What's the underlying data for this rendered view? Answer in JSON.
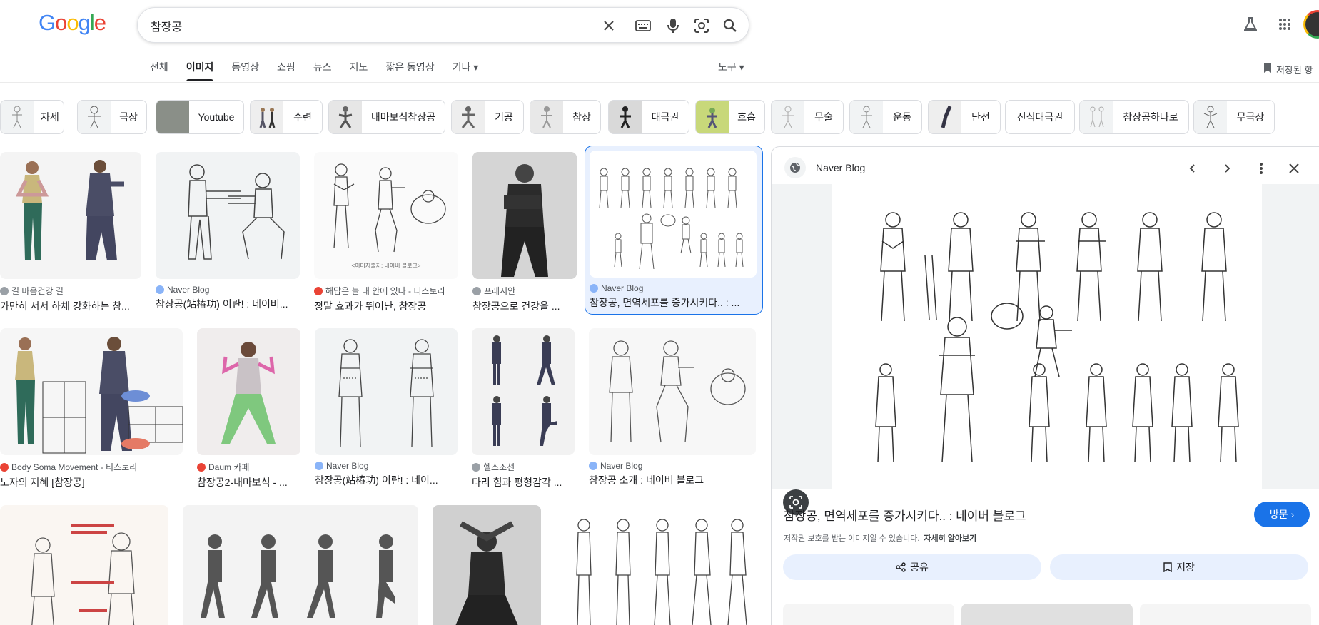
{
  "logo": [
    "G",
    "o",
    "o",
    "g",
    "l",
    "e"
  ],
  "search": {
    "value": "참장공"
  },
  "tabs": [
    "전체",
    "이미지",
    "동영상",
    "쇼핑",
    "뉴스",
    "지도",
    "짧은 동영상",
    "기타 ▾"
  ],
  "tools_label": "도구 ▾",
  "saved_label": "저장된 항",
  "chips": [
    "자세",
    "극장",
    "Youtube",
    "수련",
    "내마보식참장공",
    "기공",
    "참장",
    "태극권",
    "호흡",
    "무술",
    "운동",
    "단전",
    "진식태극권",
    "참장공하나로",
    "무극장"
  ],
  "results": [
    {
      "source": "길 마음건강 길",
      "title": "가만히 서서 하체 강화하는 참...",
      "dot": "#9aa0a6"
    },
    {
      "source": "Naver Blog",
      "title": "참장공(站樁功) 이란! : 네이버...",
      "dot": "#8ab4f8"
    },
    {
      "source": "해답은 늘 내 안에 있다 - 티스토리",
      "title": "정말 효과가 뛰어난, 참장공",
      "dot": "#ea4335"
    },
    {
      "source": "프레시안",
      "title": "참장공으로 건강을 ...",
      "dot": "#9aa0a6"
    },
    {
      "source": "Naver Blog",
      "title": "참장공, 면역세포를 증가시키다.. : ...",
      "dot": "#8ab4f8"
    },
    {
      "source": "Body Soma Movement - 티스토리",
      "title": "노자의 지혜 [참장공]",
      "dot": "#ea4335"
    },
    {
      "source": "Daum 카페",
      "title": "참장공2-내마보식 - ...",
      "dot": "#ea4335"
    },
    {
      "source": "Naver Blog",
      "title": "참장공(站樁功) 이란! : 네이...",
      "dot": "#8ab4f8"
    },
    {
      "source": "헬스조선",
      "title": "다리 힘과 평형감각 ...",
      "dot": "#9aa0a6"
    },
    {
      "source": "Naver Blog",
      "title": "참장공 소개 : 네이버 블로그",
      "dot": "#8ab4f8"
    }
  ],
  "panel": {
    "source": "Naver Blog",
    "title": "참장공, 면역세포를 증가시키다.. : 네이버 블로그",
    "visit_label": "방문 ›",
    "copyright": "저작권 보호를 받는 이미지일 수 있습니다.",
    "learn_more": "자세히 알아보기",
    "share_label": "공유",
    "save_label": "저장"
  },
  "colors": {
    "accent": "#1a73e8",
    "selected_bg": "#e8f0fe"
  }
}
